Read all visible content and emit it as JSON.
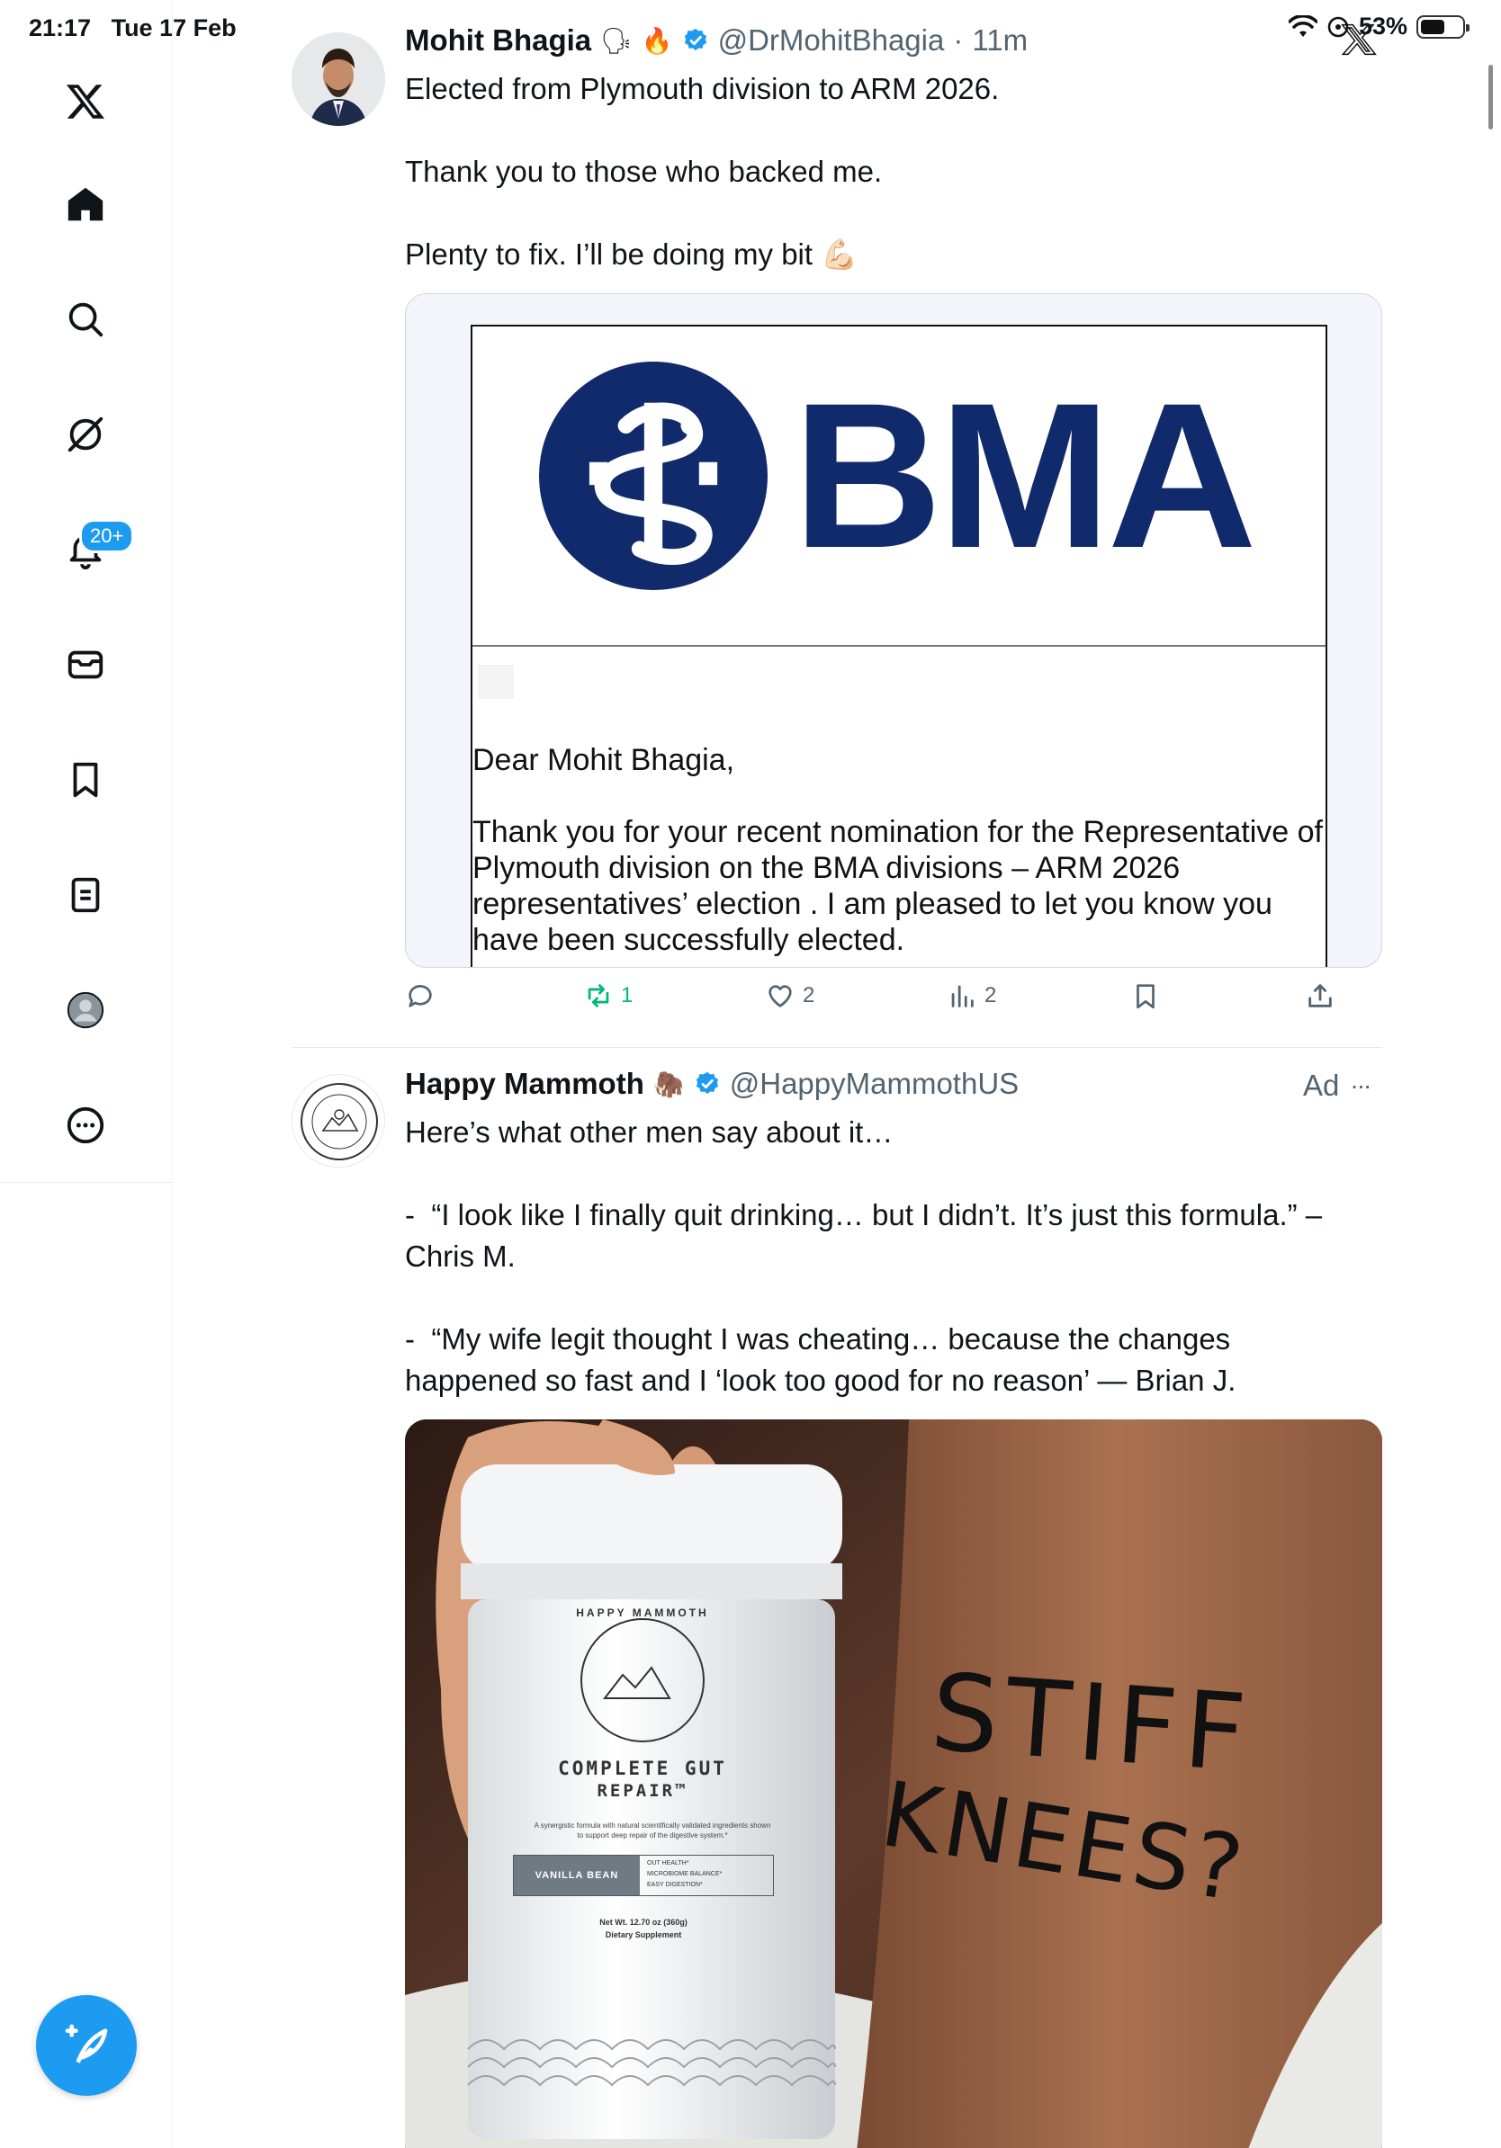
{
  "status_bar": {
    "time": "21:17",
    "date": "Tue 17 Feb",
    "battery": "53%"
  },
  "sidebar": {
    "notifications_badge": "20+"
  },
  "tweet1": {
    "name": "Mohit Bhagia",
    "handle": "@DrMohitBhagia",
    "dot": "·",
    "time": "11m",
    "text": "Elected from Plymouth division to ARM 2026.\n\nThank you to those who backed me.\n\nPlenty to fix. I’ll be doing my bit 💪🏻",
    "letter": {
      "logo_text": "BMA",
      "salutation": "Dear Mohit Bhagia,",
      "body": "Thank you for your recent nomination for the Representative of Plymouth division on the BMA divisions – ARM 2026 representatives’ election . I am pleased to let you know you have been successfully elected."
    },
    "actions": {
      "reposts": "1",
      "likes": "2",
      "views": "2"
    }
  },
  "tweet2": {
    "name": "Happy Mammoth",
    "handle": "@HappyMammothUS",
    "ad_label": "Ad",
    "more": "···",
    "text": "Here’s what other men say about it…\n\n-  “I look like I finally quit drinking… but I didn’t. It’s just this formula.” –\nChris M.\n\n-  “My wife legit thought I was cheating… because the changes\nhappened so fast and I ‘look too good for no reason’ — Brian J.",
    "product": {
      "brand_ring": "HAPPY MAMMOTH",
      "name_line1": "COMPLETE GUT",
      "name_line2": "REPAIR™",
      "description": "A synergistic formula with natural scientifically validated ingredients shown to support deep repair of the digestive system.*",
      "flavor": "VANILLA BEAN",
      "benefits": [
        "OUT HEALTH*",
        "MICROBIOME BALANCE*",
        "EASY DIGESTION*"
      ],
      "net_wt": "Net Wt. 12.70 oz (360g)",
      "supplement": "Dietary Supplement",
      "leg_text_1": "STIFF",
      "leg_text_2": "KNEES?"
    }
  },
  "colors": {
    "accent": "#1d9bf0",
    "bma_blue": "#102a6b",
    "muted_text": "#536471",
    "repost_green": "#00ba7c"
  }
}
